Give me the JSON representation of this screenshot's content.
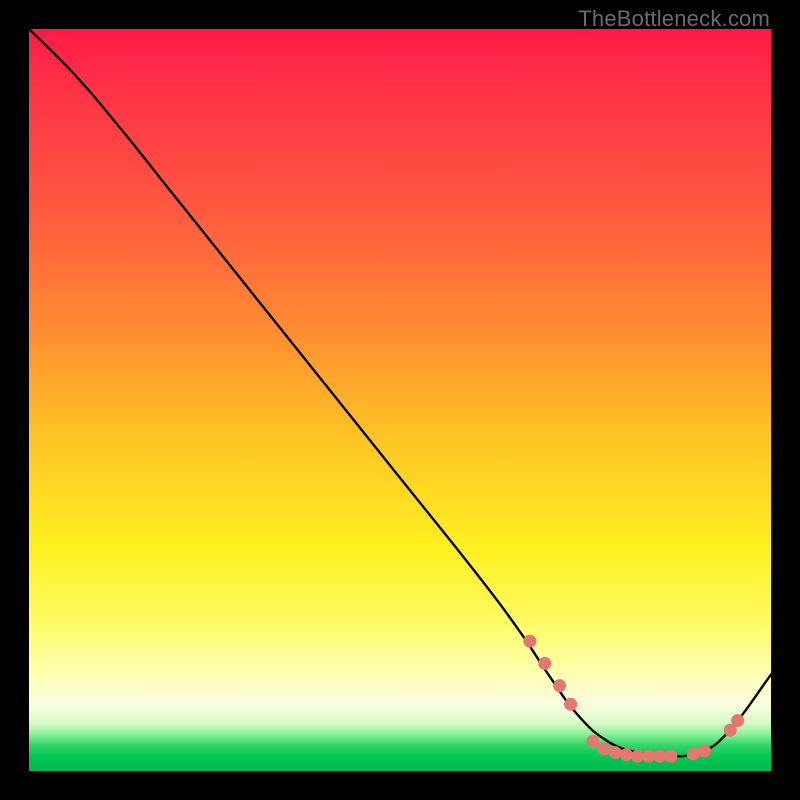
{
  "watermark": "TheBottleneck.com",
  "chart_data": {
    "type": "line",
    "title": "",
    "xlabel": "",
    "ylabel": "",
    "xlim": [
      0,
      100
    ],
    "ylim": [
      0,
      100
    ],
    "grid": false,
    "legend": false,
    "background_gradient": [
      "#ff1a46",
      "#ff8a33",
      "#fff021",
      "#fffea8",
      "#00c853"
    ],
    "series": [
      {
        "name": "curve",
        "color": "#000000",
        "x": [
          0,
          6,
          12,
          20,
          30,
          40,
          50,
          60,
          66,
          70,
          74,
          78,
          82,
          86,
          90,
          94,
          100
        ],
        "y": [
          100,
          94,
          87,
          77,
          64.5,
          52,
          39.5,
          27,
          19,
          13,
          7.5,
          4,
          2.5,
          2,
          2.5,
          5,
          13
        ]
      }
    ],
    "markers": [
      {
        "name": "dots",
        "color": "#e4776f",
        "radius_px": 6.5,
        "points": [
          {
            "x": 67.5,
            "y": 17.5
          },
          {
            "x": 69.5,
            "y": 14.5
          },
          {
            "x": 71.5,
            "y": 11.5
          },
          {
            "x": 73.0,
            "y": 9.0
          },
          {
            "x": 76.0,
            "y": 4.0
          },
          {
            "x": 77.5,
            "y": 3.0
          },
          {
            "x": 79.0,
            "y": 2.5
          },
          {
            "x": 80.5,
            "y": 2.2
          },
          {
            "x": 82.0,
            "y": 2.0
          },
          {
            "x": 83.5,
            "y": 2.0
          },
          {
            "x": 85.0,
            "y": 2.0
          },
          {
            "x": 86.5,
            "y": 2.0
          },
          {
            "x": 89.5,
            "y": 2.3
          },
          {
            "x": 91.0,
            "y": 2.7
          },
          {
            "x": 94.5,
            "y": 5.5
          },
          {
            "x": 95.5,
            "y": 6.8
          }
        ]
      }
    ]
  }
}
